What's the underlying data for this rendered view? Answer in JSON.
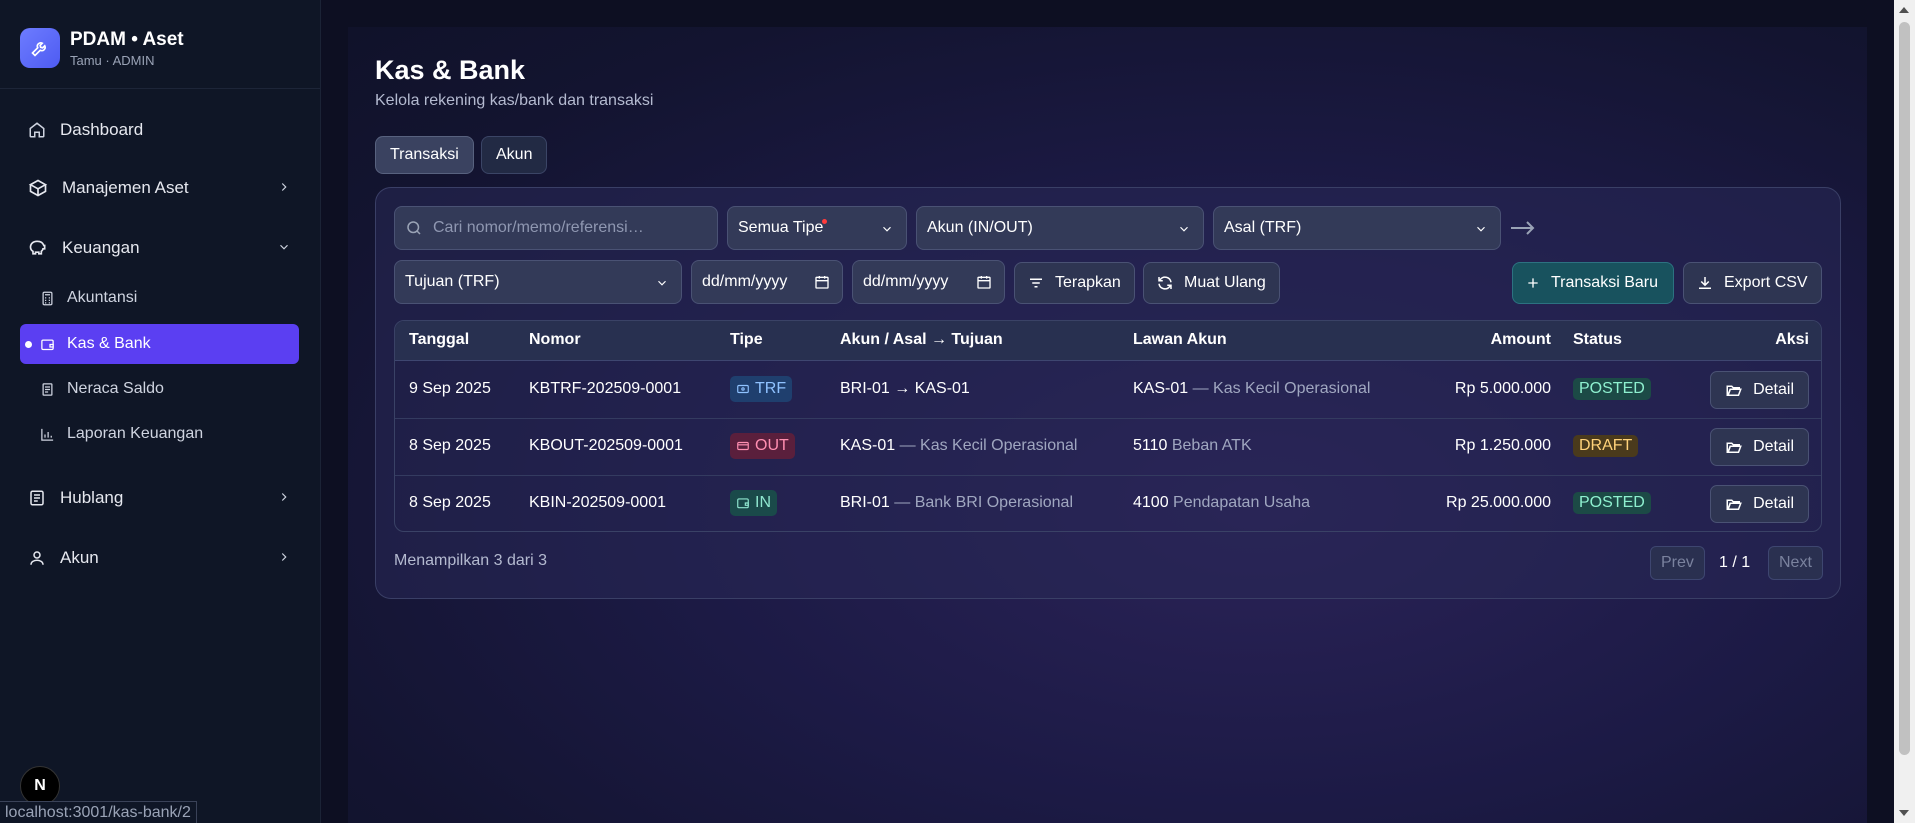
{
  "app": {
    "title": "PDAM • Aset",
    "user": "Tamu · ADMIN"
  },
  "sidebar": {
    "items": [
      {
        "label": "Dashboard",
        "icon": "home-icon"
      },
      {
        "label": "Manajemen Aset",
        "icon": "box-icon"
      },
      {
        "label": "Keuangan",
        "icon": "piggy-bank-icon"
      },
      {
        "label": "Hublang",
        "icon": "document-icon"
      },
      {
        "label": "Akun",
        "icon": "user-icon"
      }
    ],
    "sub_items": [
      {
        "label": "Akuntansi",
        "icon": "calculator-icon"
      },
      {
        "label": "Kas & Bank",
        "icon": "wallet-icon",
        "active": true
      },
      {
        "label": "Neraca Saldo",
        "icon": "receipt-icon"
      },
      {
        "label": "Laporan Keuangan",
        "icon": "bar-chart-icon"
      }
    ]
  },
  "page": {
    "title": "Kas & Bank",
    "subtitle": "Kelola rekening kas/bank dan transaksi",
    "tabs": [
      "Transaksi",
      "Akun"
    ]
  },
  "filters": {
    "search_placeholder": "Cari nomor/memo/referensi…",
    "type_select": "Semua Tipe",
    "account_select": "Akun (IN/OUT)",
    "origin_select": "Asal (TRF)",
    "destination_select": "Tujuan (TRF)",
    "date_from": "dd/mm/yyyy",
    "date_to": "dd/mm/yyyy",
    "apply_label": "Terapkan",
    "reload_label": "Muat Ulang",
    "new_label": "Transaksi Baru",
    "export_label": "Export CSV"
  },
  "table": {
    "columns": [
      "Tanggal",
      "Nomor",
      "Tipe",
      "Akun / Asal → Tujuan",
      "Lawan Akun",
      "Amount",
      "Status",
      "Aksi"
    ],
    "rows": [
      {
        "date": "9 Sep 2025",
        "number": "KBTRF-202509-0001",
        "type": "TRF",
        "account_code": "BRI-01 → KAS-01",
        "account_name": "",
        "counter_code": "KAS-01",
        "counter_name": "— Kas Kecil Operasional",
        "amount": "Rp 5.000.000",
        "status": "POSTED",
        "action": "Detail"
      },
      {
        "date": "8 Sep 2025",
        "number": "KBOUT-202509-0001",
        "type": "OUT",
        "account_code": "KAS-01",
        "account_name": "— Kas Kecil Operasional",
        "counter_code": "5110",
        "counter_name": "Beban ATK",
        "amount": "Rp 1.250.000",
        "status": "DRAFT",
        "action": "Detail"
      },
      {
        "date": "8 Sep 2025",
        "number": "KBIN-202509-0001",
        "type": "IN",
        "account_code": "BRI-01",
        "account_name": "— Bank BRI Operasional",
        "counter_code": "4100",
        "counter_name": "Pendapatan Usaha",
        "amount": "Rp 25.000.000",
        "status": "POSTED",
        "action": "Detail"
      }
    ],
    "footer": "Menampilkan 3 dari 3",
    "prev": "Prev",
    "page_info": "1 / 1",
    "next": "Next"
  },
  "statusbar": {
    "url": "localhost:3001/kas-bank/2"
  },
  "colors": {
    "accent": "#5b3ff2",
    "posted": "#8ef0cf",
    "draft": "#ffd27a"
  }
}
